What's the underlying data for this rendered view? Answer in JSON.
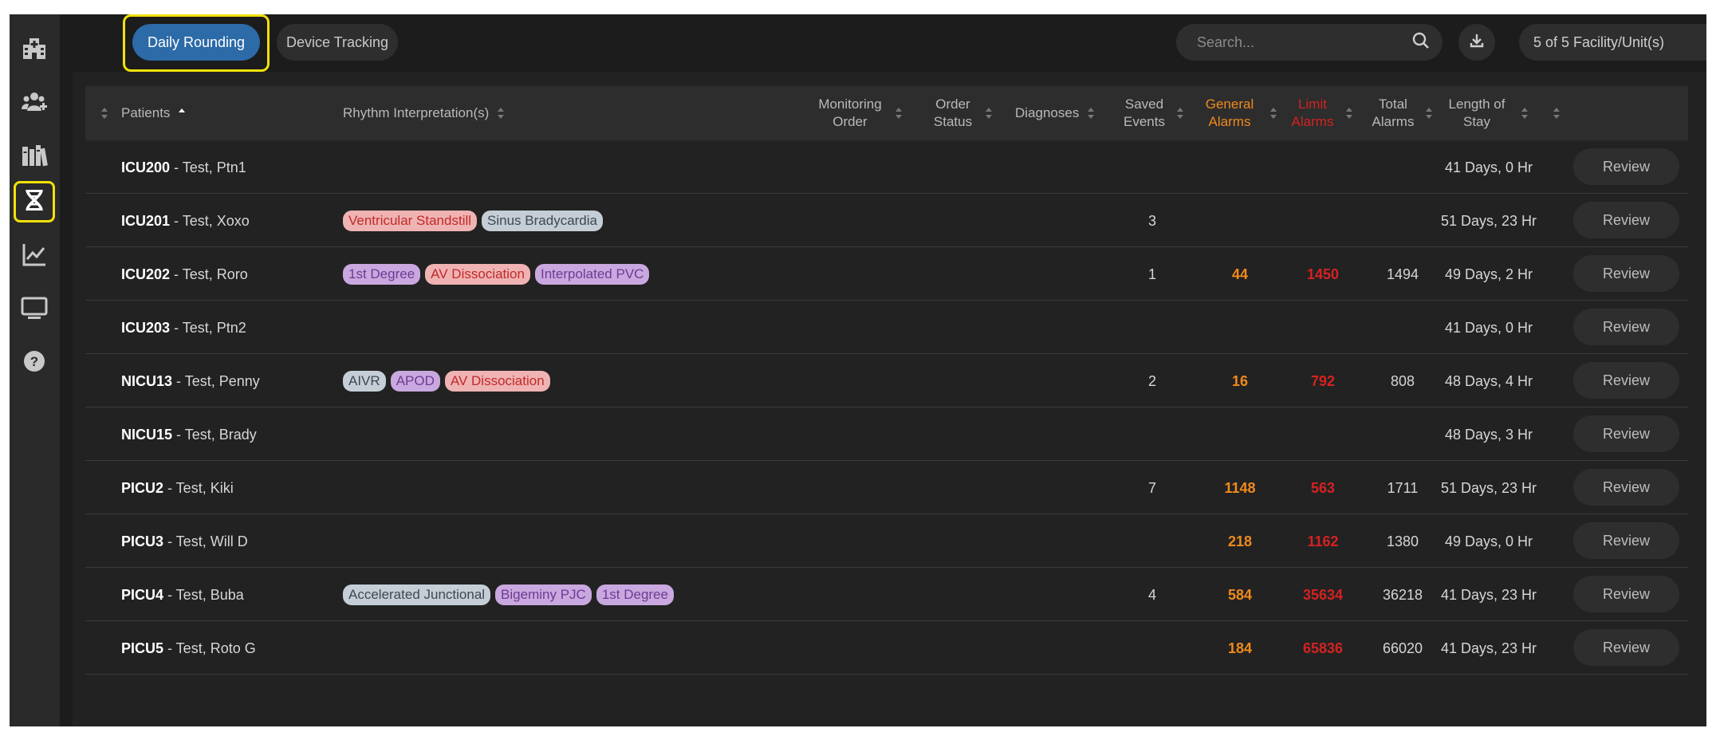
{
  "tabs": {
    "daily_rounding": "Daily Rounding",
    "device_tracking": "Device Tracking"
  },
  "search": {
    "placeholder": "Search..."
  },
  "facility_selector": {
    "value": "5 of 5 Facility/Unit(s)"
  },
  "sidebar": {
    "items": [
      {
        "icon": "hospital-icon"
      },
      {
        "icon": "add-users-icon"
      },
      {
        "icon": "library-icon"
      },
      {
        "icon": "dna-icon",
        "active": true
      },
      {
        "icon": "trend-chart-icon"
      },
      {
        "icon": "monitor-icon"
      },
      {
        "icon": "help-icon"
      }
    ]
  },
  "table": {
    "headers": {
      "patients": "Patients",
      "rhythm": "Rhythm Interpretation(s)",
      "monitoring_order": "Monitoring Order",
      "order_status": "Order Status",
      "diagnoses": "Diagnoses",
      "saved_events": "Saved Events",
      "general_alarms": "General Alarms",
      "limit_alarms": "Limit Alarms",
      "total_alarms": "Total Alarms",
      "length_of_stay": "Length of Stay"
    },
    "review_label": "Review",
    "colors": {
      "general": "#f08a1c",
      "limit": "#d42222"
    },
    "rows": [
      {
        "id": "ICU200",
        "name": " - Test, Ptn1",
        "tags": [],
        "saved": "",
        "general": "",
        "limit": "",
        "total": "",
        "stay": "41 Days, 0 Hr"
      },
      {
        "id": "ICU201",
        "name": " - Test, Xoxo",
        "tags": [
          {
            "text": "Ventricular Standstill",
            "color": "red"
          },
          {
            "text": "Sinus Bradycardia",
            "color": "gray"
          }
        ],
        "saved": "3",
        "general": "",
        "limit": "",
        "total": "",
        "stay": "51 Days, 23 Hr"
      },
      {
        "id": "ICU202",
        "name": " - Test, Roro",
        "tags": [
          {
            "text": "1st Degree",
            "color": "purple"
          },
          {
            "text": "AV Dissociation",
            "color": "red"
          },
          {
            "text": "Interpolated PVC",
            "color": "purple"
          }
        ],
        "saved": "1",
        "general": "44",
        "limit": "1450",
        "total": "1494",
        "stay": "49 Days, 2 Hr"
      },
      {
        "id": "ICU203",
        "name": " - Test, Ptn2",
        "tags": [],
        "saved": "",
        "general": "",
        "limit": "",
        "total": "",
        "stay": "41 Days, 0 Hr"
      },
      {
        "id": "NICU13",
        "name": " - Test, Penny",
        "tags": [
          {
            "text": "AIVR",
            "color": "gray"
          },
          {
            "text": "APOD",
            "color": "purple"
          },
          {
            "text": "AV Dissociation",
            "color": "red"
          }
        ],
        "saved": "2",
        "general": "16",
        "limit": "792",
        "total": "808",
        "stay": "48 Days, 4 Hr"
      },
      {
        "id": "NICU15",
        "name": " - Test, Brady",
        "tags": [],
        "saved": "",
        "general": "",
        "limit": "",
        "total": "",
        "stay": "48 Days, 3 Hr"
      },
      {
        "id": "PICU2",
        "name": " - Test, Kiki",
        "tags": [],
        "saved": "7",
        "general": "1148",
        "limit": "563",
        "total": "1711",
        "stay": "51 Days, 23 Hr"
      },
      {
        "id": "PICU3",
        "name": " - Test, Will D",
        "tags": [],
        "saved": "",
        "general": "218",
        "limit": "1162",
        "total": "1380",
        "stay": "49 Days, 0 Hr"
      },
      {
        "id": "PICU4",
        "name": " - Test, Buba",
        "tags": [
          {
            "text": "Accelerated Junctional",
            "color": "gray"
          },
          {
            "text": "Bigeminy PJC",
            "color": "purple"
          },
          {
            "text": "1st Degree",
            "color": "purple"
          }
        ],
        "saved": "4",
        "general": "584",
        "limit": "35634",
        "total": "36218",
        "stay": "41 Days, 23 Hr"
      },
      {
        "id": "PICU5",
        "name": " - Test, Roto G",
        "tags": [],
        "saved": "",
        "general": "184",
        "limit": "65836",
        "total": "66020",
        "stay": "41 Days, 23 Hr"
      }
    ]
  }
}
